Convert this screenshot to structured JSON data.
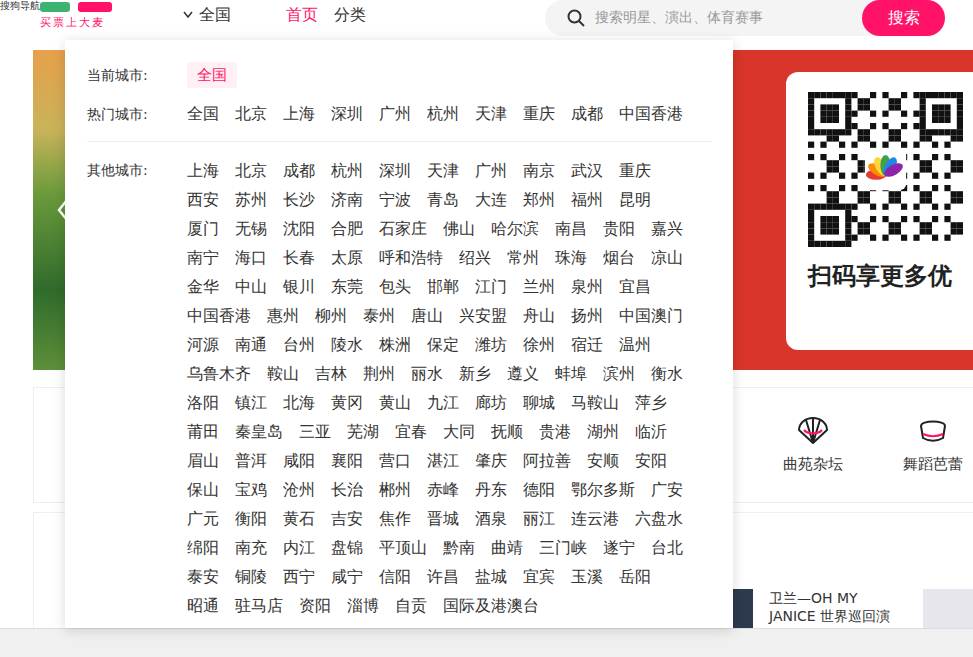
{
  "browser": {
    "bookmark": "搜狗导航"
  },
  "header": {
    "tagline": "买票上大麦",
    "city_switch": {
      "label": "全国",
      "expanded": true
    },
    "nav": [
      {
        "label": "首页",
        "selected": true
      },
      {
        "label": "分类",
        "selected": false
      }
    ],
    "search": {
      "placeholder": "搜索明星、演出、体育赛事",
      "button": "搜索"
    }
  },
  "city_menu": {
    "current_label": "当前城市:",
    "current": "全国",
    "hot_label": "热门城市:",
    "hot": [
      "全国",
      "北京",
      "上海",
      "深圳",
      "广州",
      "杭州",
      "天津",
      "重庆",
      "成都",
      "中国香港"
    ],
    "other_label": "其他城市:",
    "other_rows": [
      [
        "上海",
        "北京",
        "成都",
        "杭州",
        "深圳",
        "天津",
        "广州",
        "南京",
        "武汉",
        "重庆"
      ],
      [
        "西安",
        "苏州",
        "长沙",
        "济南",
        "宁波",
        "青岛",
        "大连",
        "郑州",
        "福州",
        "昆明"
      ],
      [
        "厦门",
        "无锡",
        "沈阳",
        "合肥",
        "石家庄",
        "佛山",
        "哈尔滨",
        "南昌",
        "贵阳",
        "嘉兴"
      ],
      [
        "南宁",
        "海口",
        "长春",
        "太原",
        "呼和浩特",
        "绍兴",
        "常州",
        "珠海",
        "烟台",
        "凉山"
      ],
      [
        "金华",
        "中山",
        "银川",
        "东莞",
        "包头",
        "邯郸",
        "江门",
        "兰州",
        "泉州",
        "宜昌"
      ],
      [
        "中国香港",
        "惠州",
        "柳州",
        "泰州",
        "唐山",
        "兴安盟",
        "舟山",
        "扬州",
        "中国澳门"
      ],
      [
        "河源",
        "南通",
        "台州",
        "陵水",
        "株洲",
        "保定",
        "潍坊",
        "徐州",
        "宿迁",
        "温州"
      ],
      [
        "乌鲁木齐",
        "鞍山",
        "吉林",
        "荆州",
        "丽水",
        "新乡",
        "遵义",
        "蚌埠",
        "滨州",
        "衡水"
      ],
      [
        "洛阳",
        "镇江",
        "北海",
        "黄冈",
        "黄山",
        "九江",
        "廊坊",
        "聊城",
        "马鞍山",
        "萍乡"
      ],
      [
        "莆田",
        "秦皇岛",
        "三亚",
        "芜湖",
        "宜春",
        "大同",
        "抚顺",
        "贵港",
        "湖州",
        "临沂"
      ],
      [
        "眉山",
        "普洱",
        "咸阳",
        "襄阳",
        "营口",
        "湛江",
        "肇庆",
        "阿拉善",
        "安顺",
        "安阳"
      ],
      [
        "保山",
        "宝鸡",
        "沧州",
        "长治",
        "郴州",
        "赤峰",
        "丹东",
        "德阳",
        "鄂尔多斯",
        "广安"
      ],
      [
        "广元",
        "衡阳",
        "黄石",
        "吉安",
        "焦作",
        "晋城",
        "酒泉",
        "丽江",
        "连云港",
        "六盘水"
      ],
      [
        "绵阳",
        "南充",
        "内江",
        "盘锦",
        "平顶山",
        "黔南",
        "曲靖",
        "三门峡",
        "遂宁",
        "台北"
      ],
      [
        "泰安",
        "铜陵",
        "西宁",
        "咸宁",
        "信阳",
        "许昌",
        "盐城",
        "宜宾",
        "玉溪",
        "岳阳"
      ],
      [
        "昭通",
        "驻马店",
        "资阳",
        "淄博",
        "自贡",
        "国际及港澳台"
      ]
    ]
  },
  "banner": {
    "qr_caption": "扫码享更多优"
  },
  "categories": [
    {
      "label": "曲苑杂坛",
      "kind": "fan"
    },
    {
      "label": "舞蹈芭蕾",
      "kind": "hat"
    }
  ],
  "recommend": {
    "title": "卫兰—OH MY JANICE 世界巡回演"
  }
}
